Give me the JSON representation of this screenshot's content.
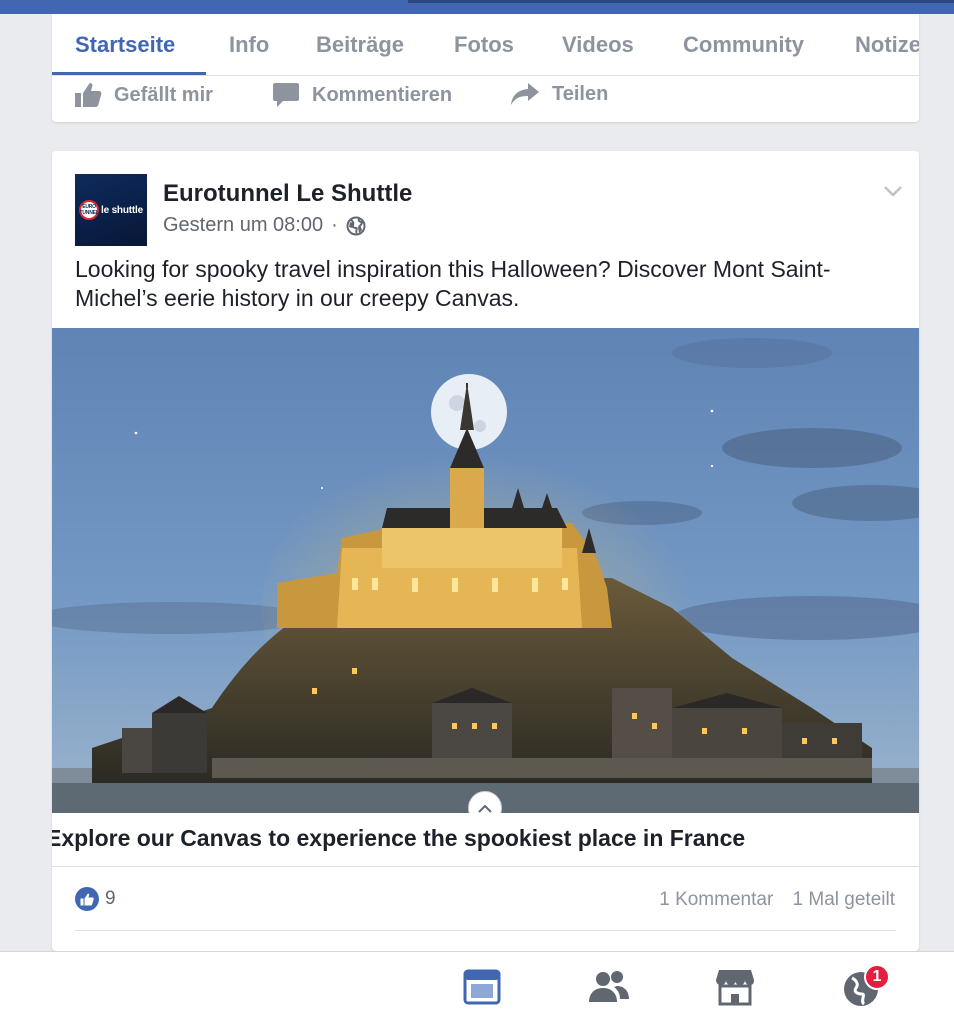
{
  "tabs": [
    {
      "label": "Startseite",
      "active": true
    },
    {
      "label": "Info"
    },
    {
      "label": "Beiträge"
    },
    {
      "label": "Fotos"
    },
    {
      "label": "Videos"
    },
    {
      "label": "Community"
    },
    {
      "label": "Notize"
    }
  ],
  "actions": {
    "like": "Gefällt mir",
    "comment": "Kommentieren",
    "share": "Teilen"
  },
  "post": {
    "page_name": "Eurotunnel Le Shuttle",
    "avatar_text": "le shuttle",
    "avatar_badge": "EURO TUNNEL",
    "timestamp": "Gestern um 08:00",
    "separator": "·",
    "text": "Looking for spooky travel inspiration this Halloween? Discover Mont Saint-Michel’s eerie history in our creepy Canvas.",
    "caption": "Explore our Canvas to experience the spookiest place in France",
    "like_count": "9",
    "comments": "1 Kommentar",
    "shares": "1 Mal geteilt"
  },
  "bottom_nav": {
    "items": [
      "news-feed-icon",
      "friends-icon",
      "marketplace-icon",
      "notifications-globe-icon"
    ],
    "notification_count": "1"
  },
  "colors": {
    "brand_blue": "#4267b2",
    "muted_text": "#8d949e",
    "notification_red": "#e41e3f"
  }
}
